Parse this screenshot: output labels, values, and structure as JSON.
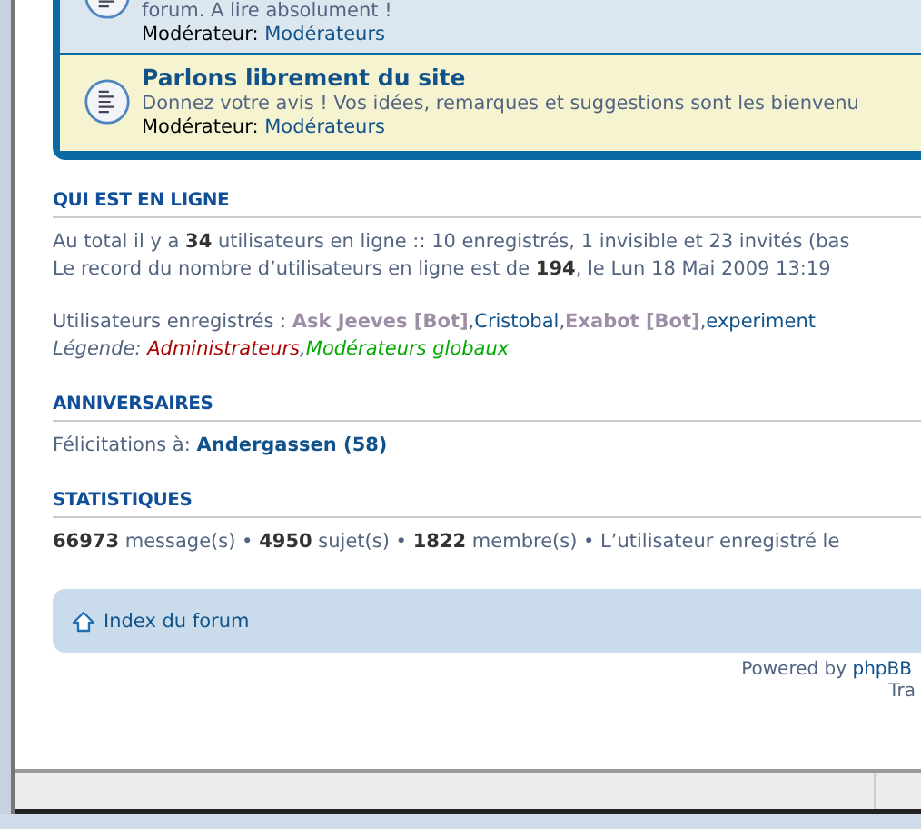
{
  "forums": [
    {
      "description": "forum. A lire absolument !",
      "moderator_label": "Modérateur:",
      "moderator": "Modérateurs",
      "highlighted": false
    },
    {
      "title": "Parlons librement du site",
      "description": "Donnez votre avis ! Vos idées, remarques et suggestions sont les bienvenu",
      "moderator_label": "Modérateur:",
      "moderator": "Modérateurs",
      "highlighted": true
    }
  ],
  "online": {
    "heading": "QUI EST EN LIGNE",
    "lines": [
      "Au total il y a **34** utilisateurs en ligne :: 10 enregistrés, 1 invisible et 23 invités (bas",
      "Le record du nombre d’utilisateurs en ligne est de **194**, le Lun 18 Mai 2009 13:19"
    ],
    "registered_label": "Utilisateurs enregistrés :",
    "separator": ",",
    "users": [
      {
        "name": "Ask Jeeves [Bot]",
        "kind": "bot"
      },
      {
        "name": "Cristobal",
        "kind": "user"
      },
      {
        "name": "Exabot [Bot]",
        "kind": "bot"
      },
      {
        "name": "experiment",
        "kind": "user"
      }
    ],
    "legend_label": "Légende:",
    "legend": [
      {
        "name": "Administrateurs",
        "color": "#aa0000"
      },
      {
        "name": "Modérateurs globaux",
        "color": "#00aa00"
      }
    ]
  },
  "birthdays": {
    "heading": "ANNIVERSAIRES",
    "label": "Félicitations à:",
    "name": "Andergassen (58)"
  },
  "statistics": {
    "heading": "STATISTIQUES",
    "text": "**66973** message(s) • **4950** sujet(s) • **1822** membre(s) • L’utilisateur enregistré le"
  },
  "navbar": {
    "link": "Index du forum"
  },
  "footer": {
    "powered_label": "Powered by",
    "powered_link": "phpBB",
    "translation": "Tra"
  }
}
